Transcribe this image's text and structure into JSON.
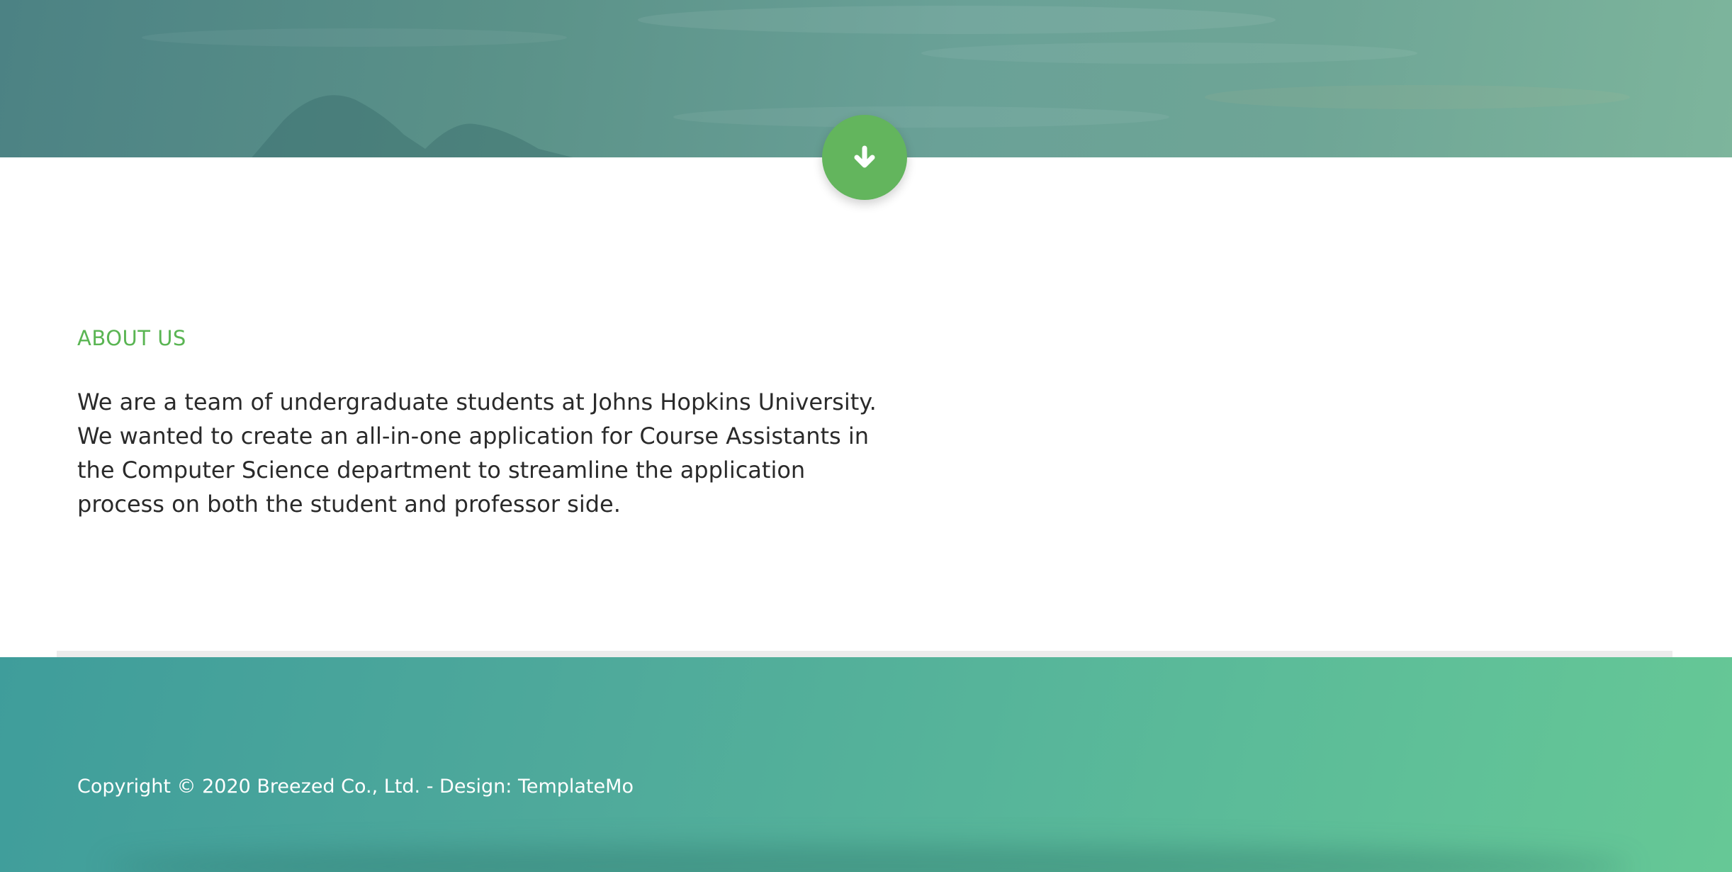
{
  "scroll_button": {
    "icon": "arrow-down-icon"
  },
  "about": {
    "heading": "ABOUT US",
    "paragraph": "We are a team of undergraduate students at Johns Hopkins University. We wanted to create an all-in-one application for Course Assistants in the Computer Science department to streamline the application process on both the student and professor side."
  },
  "footer": {
    "copyright_prefix": "Copyright © 2020 Breezed Co., Ltd. - Design: ",
    "design_link": "TemplateMo"
  },
  "colors": {
    "accent_green": "#5ab553",
    "button_green": "#63b55d",
    "footer_start": "#3f9d9b",
    "footer_end": "#66c896",
    "body_text": "#2a2a2a"
  }
}
